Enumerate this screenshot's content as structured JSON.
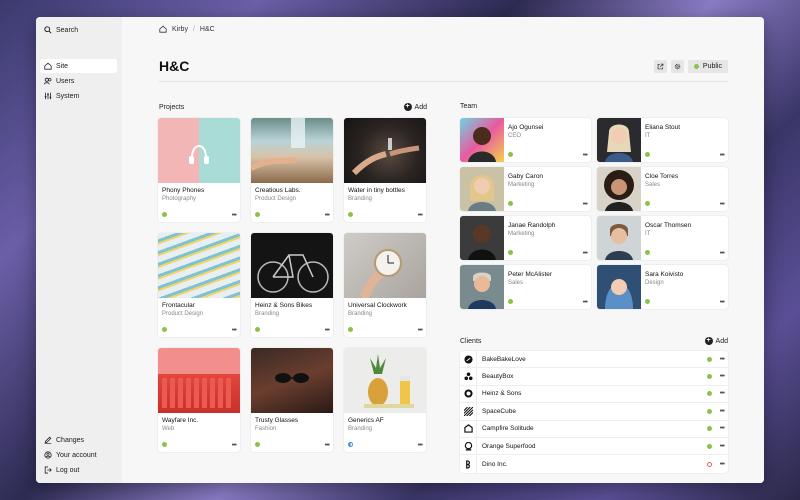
{
  "sidebar": {
    "search_label": "Search",
    "items": [
      {
        "label": "Site",
        "icon": "home-icon"
      },
      {
        "label": "Users",
        "icon": "users-icon"
      },
      {
        "label": "System",
        "icon": "sliders-icon"
      }
    ],
    "bottom": [
      {
        "label": "Changes",
        "icon": "pencil-icon"
      },
      {
        "label": "Your account",
        "icon": "account-icon"
      },
      {
        "label": "Log out",
        "icon": "logout-icon"
      }
    ]
  },
  "breadcrumb": {
    "root": "Kirby",
    "current": "H&C"
  },
  "page": {
    "title": "H&C",
    "public_label": "Public"
  },
  "projects": {
    "heading": "Projects",
    "add_label": "Add",
    "items": [
      {
        "title": "Phony Phones",
        "subtitle": "Photography",
        "status": "published"
      },
      {
        "title": "Creatious Labs.",
        "subtitle": "Product Design",
        "status": "published"
      },
      {
        "title": "Water in tiny bottles",
        "subtitle": "Branding",
        "status": "published"
      },
      {
        "title": "Frontacular",
        "subtitle": "Product Design",
        "status": "published"
      },
      {
        "title": "Heinz & Sons Bikes",
        "subtitle": "Branding",
        "status": "published"
      },
      {
        "title": "Universal Clockwork",
        "subtitle": "Branding",
        "status": "published"
      },
      {
        "title": "Wayfare Inc.",
        "subtitle": "Web",
        "status": "published"
      },
      {
        "title": "Trusty Glasses",
        "subtitle": "Fashion",
        "status": "published"
      },
      {
        "title": "Generics AF",
        "subtitle": "Branding",
        "status": "unlisted"
      }
    ]
  },
  "team": {
    "heading": "Team",
    "members": [
      {
        "name": "Ajo Ogunsei",
        "role": "CEO"
      },
      {
        "name": "Eliana Stout",
        "role": "IT"
      },
      {
        "name": "Gaby Caron",
        "role": "Marketing"
      },
      {
        "name": "Cloe Torres",
        "role": "Sales"
      },
      {
        "name": "Janae Randolph",
        "role": "Marketing"
      },
      {
        "name": "Oscar Thomsen",
        "role": "IT"
      },
      {
        "name": "Peter McAlister",
        "role": "Sales"
      },
      {
        "name": "Sara Koivisto",
        "role": "Design"
      }
    ]
  },
  "clients": {
    "heading": "Clients",
    "add_label": "Add",
    "items": [
      {
        "name": "BakeBakeLove",
        "status": "published"
      },
      {
        "name": "BeautyBox",
        "status": "published"
      },
      {
        "name": "Heinz & Sons",
        "status": "published"
      },
      {
        "name": "SpaceCube",
        "status": "published"
      },
      {
        "name": "Campfire Solitude",
        "status": "published"
      },
      {
        "name": "Orange Superfood",
        "status": "published"
      },
      {
        "name": "Dino Inc.",
        "status": "draft"
      }
    ]
  },
  "more_label": "•••"
}
